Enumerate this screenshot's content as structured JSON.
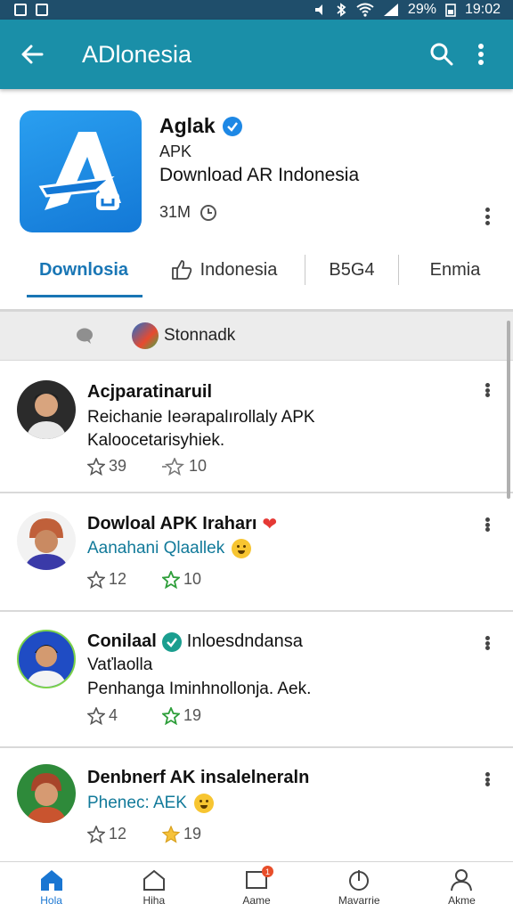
{
  "status_bar": {
    "battery": "29%",
    "time": "19:02"
  },
  "app_bar": {
    "title": "ADlonesia"
  },
  "app": {
    "name": "Aglak",
    "type": "APK",
    "description": "Download AR Indonesia",
    "downloads": "31M",
    "accent_color": "#1a8fa8"
  },
  "tabs": [
    {
      "label": "Downlosia"
    },
    {
      "label": "Indonesia"
    },
    {
      "label": "B5G4"
    },
    {
      "label": "Enmia"
    }
  ],
  "filter": {
    "store_label": "Stonnadk"
  },
  "posts": [
    {
      "name": "Acjparatinaruil",
      "line1": "Reichanie Ieərapalırollaly APK",
      "line2": "Kaloocetarisyhiek.",
      "stat1": "39",
      "stat2": "10"
    },
    {
      "name": "Dowloal APK Iraharı",
      "line1": "Aanahani Qlaallek",
      "stat1": "12",
      "stat2": "10"
    },
    {
      "name": "Conilaal",
      "name_suffix": "Inloesdndansa",
      "line1": "Vaťlaolla",
      "line2": "Penhanga Iminhnollonja. Aek.",
      "stat1": "4",
      "stat2": "19"
    },
    {
      "name": "Denbnerf AK insalelneraln",
      "line1": "Phenec: AEK",
      "stat1": "12",
      "stat2": "19"
    }
  ],
  "bottom_nav": [
    {
      "label": "Hola",
      "icon": "home-filled-icon"
    },
    {
      "label": "Hiha",
      "icon": "home-outline-icon"
    },
    {
      "label": "Aame",
      "icon": "inbox-icon",
      "badge": "1"
    },
    {
      "label": "Mavarrie",
      "icon": "power-icon"
    },
    {
      "label": "Akme",
      "icon": "profile-icon"
    }
  ]
}
